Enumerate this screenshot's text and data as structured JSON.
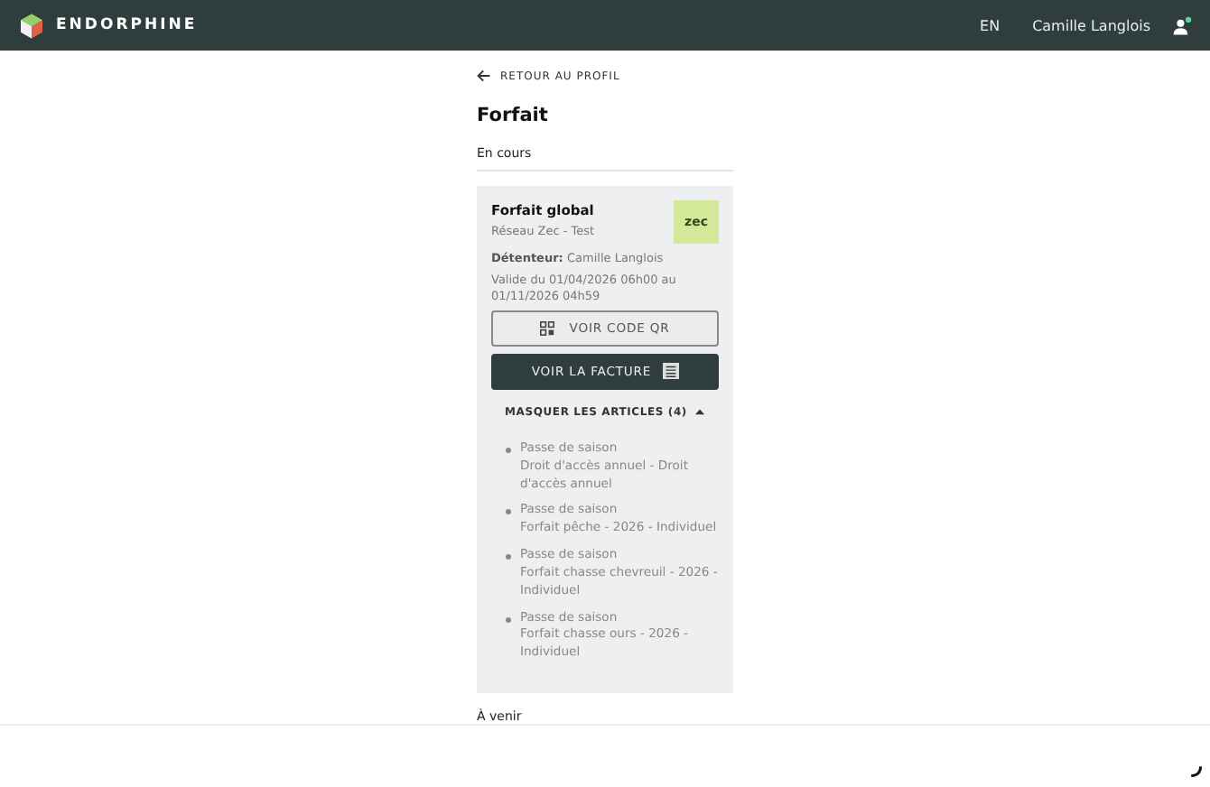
{
  "header": {
    "brand": "ENDORPHINE",
    "language": "EN",
    "user_name": "Camille Langlois",
    "notification": true
  },
  "back_link": "RETOUR AU PROFIL",
  "title": "Forfait",
  "current_section": "En cours",
  "card": {
    "name": "Forfait global",
    "network": "Réseau Zec - Test",
    "logo_text": "zec",
    "holder_label": "Détenteur:",
    "holder": "Camille Langlois",
    "validity": "Valide du 01/04/2026 06h00 au 01/11/2026 04h59",
    "qr_button": "VOIR CODE QR",
    "invoice_button": "VOIR LA FACTURE",
    "toggle": "MASQUER LES ARTICLES (4)",
    "expanded": true,
    "articles": [
      {
        "type": "Passe de saison",
        "description": "Droit d'accès annuel - Droit d'accès annuel"
      },
      {
        "type": "Passe de saison",
        "description": "Forfait pêche - 2026 - Individuel"
      },
      {
        "type": "Passe de saison",
        "description": "Forfait chasse chevreuil - 2026 - Individuel"
      },
      {
        "type": "Passe de saison",
        "description": "Forfait chasse ours - 2026 - Individuel"
      }
    ]
  },
  "upcoming_section": "À venir"
}
